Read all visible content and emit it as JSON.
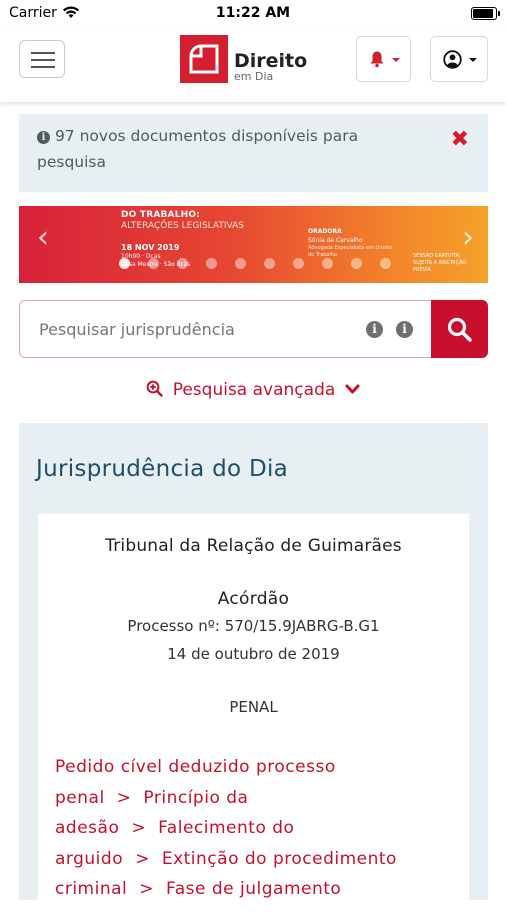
{
  "status_bar": {
    "carrier": "Carrier",
    "time": "11:22 AM"
  },
  "header": {
    "logo_title": "Direito",
    "logo_subtitle": "em Dia"
  },
  "alert": {
    "icon": "info-circle-icon",
    "text": "97 novos documentos disponíveis para pesquisa",
    "close_icon": "close-x-icon"
  },
  "banner": {
    "line1": "DO TRABALHO:",
    "line2": "ALTERAÇÕES LEGISLATIVAS",
    "date": "18 NOV 2019",
    "small1": "10h00 · Ocas",
    "small2": "Casa Mestre · São Brás",
    "speaker_label": "ORADORA",
    "speaker_name": "Sónia de Carvalho",
    "speaker_sub": "Advogada Especialista em Direito do Trabalho",
    "right_text": "SESSÃO GRATUITA, SUJEITA A INSCRIÇÃO PRÉVIA",
    "slides": 10,
    "active_slide": 0
  },
  "search": {
    "placeholder": "Pesquisar jurisprudência",
    "button_icon": "search-icon"
  },
  "advanced_search": {
    "label": "Pesquisa avançada"
  },
  "jurisprudence": {
    "title": "Jurisprudência do Dia",
    "court": "Tribunal da Relação de Guimarães",
    "doc_type": "Acórdão",
    "process": "Processo nº: 570/15.9JABRG-B.G1",
    "date": "14 de outubro de 2019",
    "area": "PENAL",
    "keywords": [
      "Pedido cível deduzido processo penal",
      "Princípio da adesão",
      "Falecimento do arguido",
      "Extinção do procedimento criminal",
      "Fase de julgamento"
    ],
    "separator": ">"
  },
  "colors": {
    "brand_red": "#c8102e",
    "title_blue": "#1f4e6b",
    "panel_bg": "#e7eff2"
  }
}
